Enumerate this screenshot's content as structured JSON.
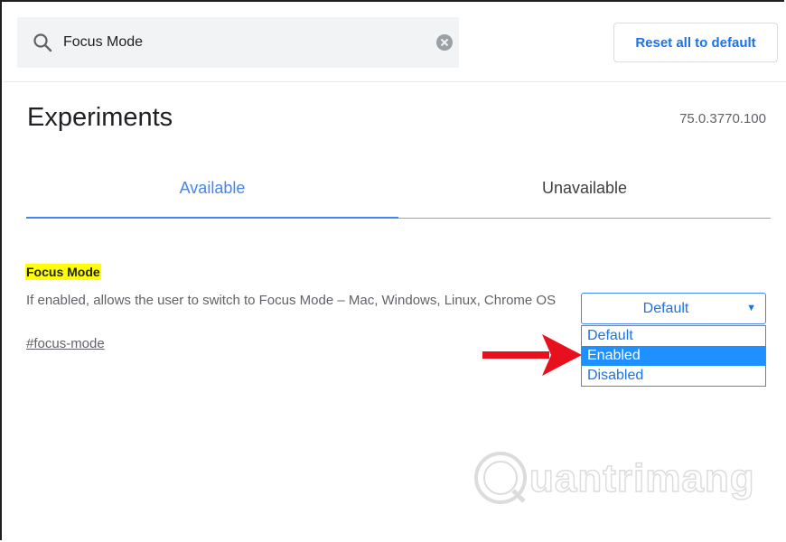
{
  "search": {
    "value": "Focus Mode"
  },
  "header": {
    "reset_label": "Reset all to default"
  },
  "page": {
    "title": "Experiments",
    "version": "75.0.3770.100"
  },
  "tabs": [
    {
      "label": "Available",
      "active": true
    },
    {
      "label": "Unavailable",
      "active": false
    }
  ],
  "experiment": {
    "name": "Focus Mode",
    "description": "If enabled, allows the user to switch to Focus Mode – Mac, Windows, Linux, Chrome OS",
    "link": "#focus-mode",
    "select_value": "Default",
    "options": [
      {
        "label": "Default",
        "highlighted": false
      },
      {
        "label": "Enabled",
        "highlighted": true
      },
      {
        "label": "Disabled",
        "highlighted": false
      }
    ]
  },
  "watermark": {
    "text": "uantrimang"
  },
  "colors": {
    "accent": "#4285f4",
    "highlight": "#ffff00",
    "selected_option": "#1e90ff",
    "arrow": "#e8101c"
  },
  "icons": {
    "search": "search-icon",
    "clear": "clear-icon",
    "dropdown": "dropdown-arrow-icon",
    "pointer": "red-arrow-icon"
  }
}
